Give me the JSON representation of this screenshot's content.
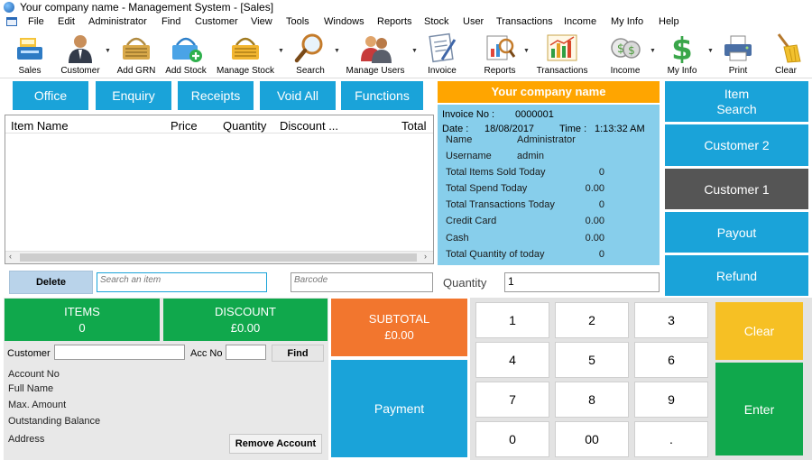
{
  "window": {
    "title": "Your company name - Management System - [Sales]"
  },
  "menu": [
    "File",
    "Edit",
    "Administrator",
    "Find",
    "Customer",
    "View",
    "Tools",
    "Windows",
    "Reports",
    "Stock",
    "User",
    "Transactions",
    "Income",
    "My Info",
    "Help"
  ],
  "toolbar": [
    {
      "label": "Sales",
      "icon": "register-icon"
    },
    {
      "label": "Customer",
      "icon": "person-icon"
    },
    {
      "label": "Add GRN",
      "icon": "basket-icon"
    },
    {
      "label": "Add Stock",
      "icon": "basket-add-icon"
    },
    {
      "label": "Manage Stock",
      "icon": "basket-gold-icon"
    },
    {
      "label": "Search",
      "icon": "magnifier-icon"
    },
    {
      "label": "Manage Users",
      "icon": "users-icon"
    },
    {
      "label": "Invoice",
      "icon": "invoice-icon"
    },
    {
      "label": "Reports",
      "icon": "report-icon"
    },
    {
      "label": "Transactions",
      "icon": "chart-icon"
    },
    {
      "label": "Income",
      "icon": "coins-icon"
    },
    {
      "label": "My Info",
      "icon": "dollar-icon"
    },
    {
      "label": "Print",
      "icon": "printer-icon"
    },
    {
      "label": "Clear",
      "icon": "broom-icon"
    }
  ],
  "tabs": [
    "Office",
    "Enquiry",
    "Receipts",
    "Void All",
    "Functions"
  ],
  "grid": {
    "columns": [
      "Item Name",
      "Price",
      "Quantity",
      "Discount ...",
      "Total"
    ]
  },
  "delete_label": "Delete",
  "search": {
    "placeholder": "Search an item"
  },
  "barcode": {
    "placeholder": "Barcode"
  },
  "quantity": {
    "label": "Quantity",
    "value": "1"
  },
  "company": {
    "name": "Your company name"
  },
  "invoice": {
    "no_label": "Invoice No :",
    "no": "0000001",
    "date_label": "Date :",
    "date": "18/08/2017",
    "time_label": "Time :",
    "time": "1:13:32 AM",
    "name_label": "Name",
    "name": "Administrator",
    "username_label": "Username",
    "username": "admin",
    "stats": [
      {
        "label": "Total Items Sold Today",
        "value": "0"
      },
      {
        "label": "Total Spend Today",
        "value": "0.00"
      },
      {
        "label": "Total Transactions Today",
        "value": "0"
      },
      {
        "label": "Credit Card",
        "value": "0.00"
      },
      {
        "label": "Cash",
        "value": "0.00"
      },
      {
        "label": "Total Quantity of today",
        "value": "0"
      }
    ]
  },
  "side_buttons": [
    "Item\nSearch",
    "Customer 2",
    "Customer 1",
    "Payout",
    "Refund"
  ],
  "items_tile": {
    "label": "ITEMS",
    "value": "0"
  },
  "discount_tile": {
    "label": "DISCOUNT",
    "value": "£0.00"
  },
  "subtotal_tile": {
    "label": "SUBTOTAL",
    "value": "£0.00"
  },
  "payment_label": "Payment",
  "customer": {
    "customer_label": "Customer",
    "acc_label": "Acc No",
    "find_label": "Find",
    "fields": [
      "Account No",
      "Full Name",
      "Max. Amount",
      "Outstanding Balance",
      "Address"
    ],
    "remove_label": "Remove Account"
  },
  "keypad": [
    "1",
    "2",
    "3",
    "4",
    "5",
    "6",
    "7",
    "8",
    "9",
    "0",
    "00",
    "."
  ],
  "clear_label": "Clear",
  "enter_label": "Enter",
  "colors": {
    "blue": "#1aa3d9",
    "green": "#10a84c",
    "orange": "#f2762e",
    "yellow": "#f6c024",
    "info_bg": "#87ceeb",
    "company_bar": "#ffa500",
    "dark_button": "#555555"
  }
}
